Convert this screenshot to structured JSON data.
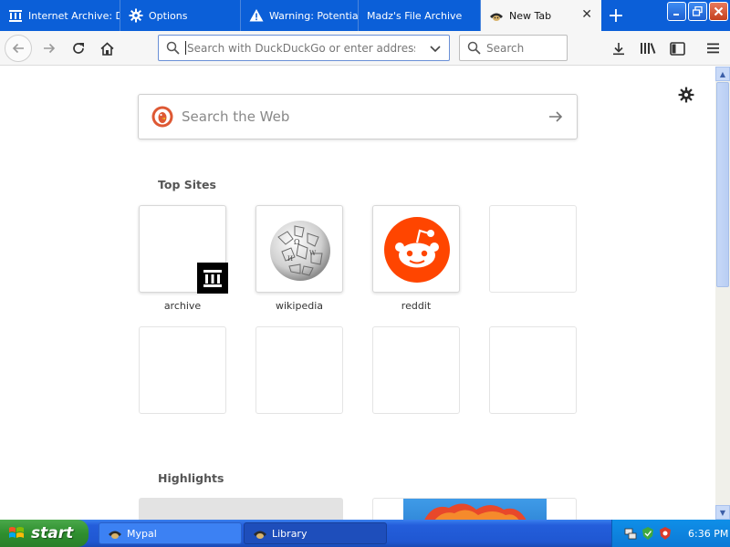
{
  "window": {
    "tabs": [
      {
        "label": "Internet Archive: D",
        "icon": "archive-icon"
      },
      {
        "label": "Options",
        "icon": "gear-icon"
      },
      {
        "label": "Warning: Potential",
        "icon": "warning-icon"
      },
      {
        "label": "Madz's File Archive",
        "icon": ""
      },
      {
        "label": "New Tab",
        "icon": "pirate-icon",
        "active": true
      }
    ],
    "new_tab_symbol": "+",
    "close_tab_symbol": "✕"
  },
  "toolbar": {
    "url_placeholder": "Search with DuckDuckGo or enter address",
    "search_placeholder": "Search"
  },
  "newtab": {
    "web_search_placeholder": "Search the Web",
    "top_sites_title": "Top Sites",
    "highlights_title": "Highlights",
    "top_sites": [
      {
        "label": "archive",
        "icon": "archive-icon"
      },
      {
        "label": "wikipedia",
        "icon": "wikipedia-icon"
      },
      {
        "label": "reddit",
        "icon": "reddit-icon"
      },
      {
        "label": "",
        "icon": ""
      },
      {
        "label": "",
        "icon": ""
      },
      {
        "label": "",
        "icon": ""
      },
      {
        "label": "",
        "icon": ""
      },
      {
        "label": "",
        "icon": ""
      }
    ]
  },
  "taskbar": {
    "start_label": "start",
    "items": [
      {
        "label": "Mypal",
        "icon": "pirate-icon"
      },
      {
        "label": "Library",
        "icon": "pirate-icon"
      }
    ],
    "clock": "6:36 PM"
  },
  "colors": {
    "tabstrip": "#0b5fd8",
    "reddit": "#ff4500",
    "ddg": "#de5833",
    "taskbar": "#245edb",
    "start": "#2f8f2f"
  }
}
